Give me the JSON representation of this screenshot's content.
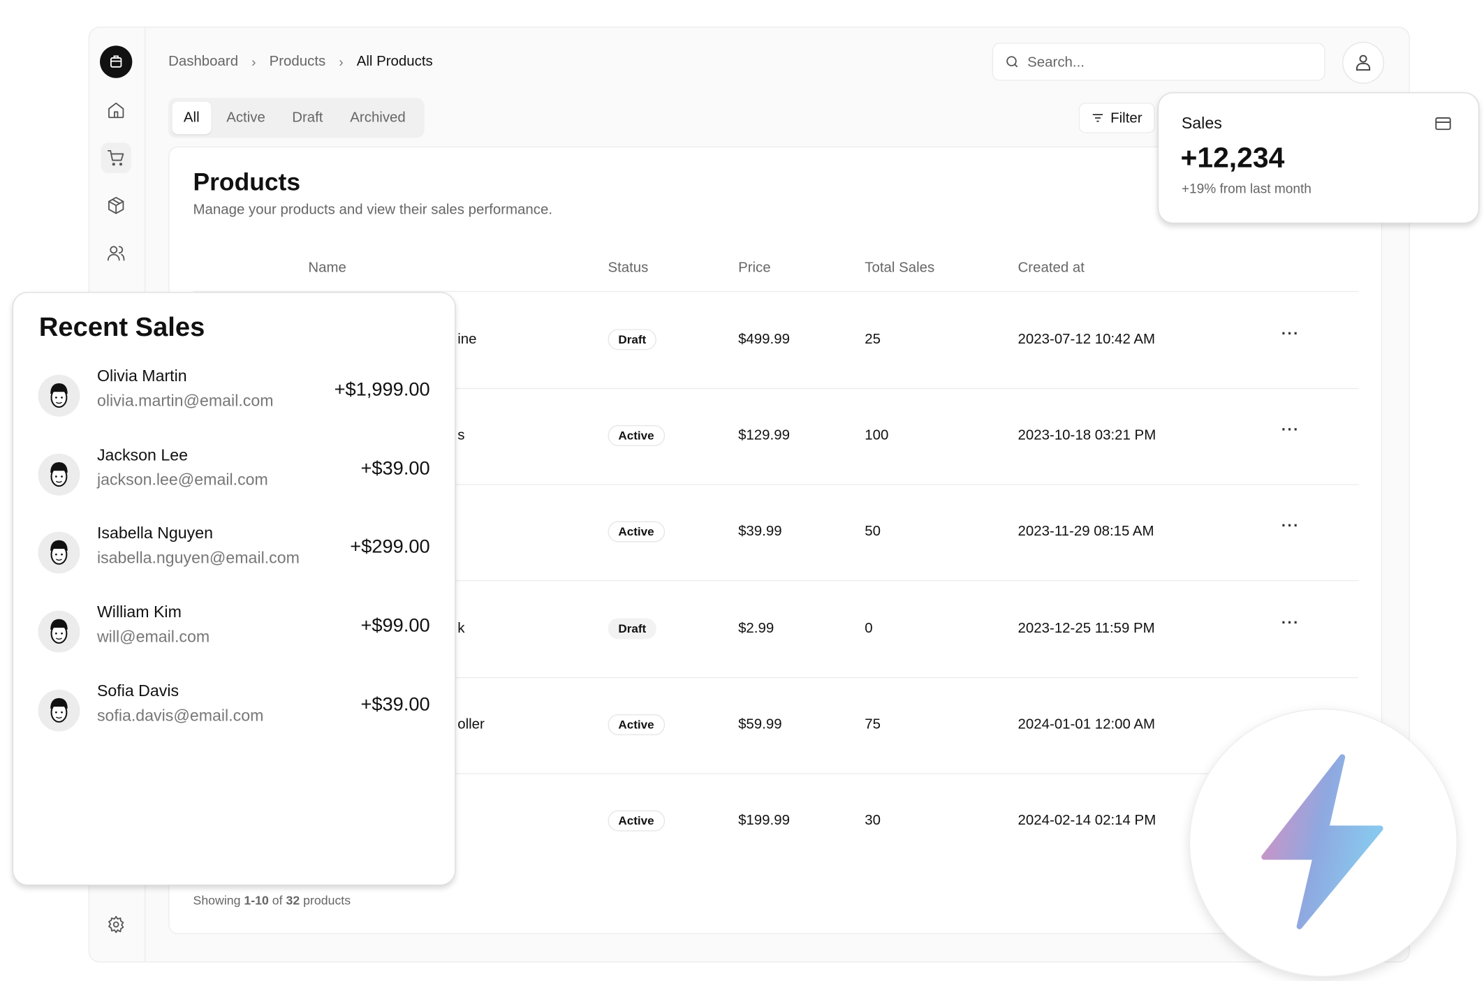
{
  "breadcrumb": [
    "Dashboard",
    "Products",
    "All Products"
  ],
  "search": {
    "placeholder": "Search..."
  },
  "tabs": [
    "All",
    "Active",
    "Draft",
    "Archived"
  ],
  "filter_label": "Filter",
  "products": {
    "title": "Products",
    "subtitle": "Manage your products and view their sales performance.",
    "columns": [
      "Name",
      "Status",
      "Price",
      "Total Sales",
      "Created at"
    ],
    "rows": [
      {
        "name": "ine",
        "status": "Draft",
        "price": "$499.99",
        "sales": "25",
        "created": "2023-07-12 10:42 AM"
      },
      {
        "name": "s",
        "status": "Active",
        "price": "$129.99",
        "sales": "100",
        "created": "2023-10-18 03:21 PM"
      },
      {
        "name": "",
        "status": "Active",
        "price": "$39.99",
        "sales": "50",
        "created": "2023-11-29 08:15 AM"
      },
      {
        "name": "k",
        "status": "Draft",
        "price": "$2.99",
        "sales": "0",
        "created": "2023-12-25 11:59 PM"
      },
      {
        "name": "oller",
        "status": "Active",
        "price": "$59.99",
        "sales": "75",
        "created": "2024-01-01 12:00 AM"
      },
      {
        "name": "",
        "status": "Active",
        "price": "$199.99",
        "sales": "30",
        "created": "2024-02-14 02:14 PM"
      }
    ],
    "footer": {
      "prefix": "Showing",
      "range": "1-10",
      "of": "of",
      "total": "32",
      "suffix": "products"
    }
  },
  "sales_card": {
    "title": "Sales",
    "value": "+12,234",
    "delta": "+19% from last month",
    "icon": "credit-card-icon"
  },
  "recent_sales": {
    "title": "Recent Sales",
    "items": [
      {
        "name": "Olivia Martin",
        "email": "olivia.martin@email.com",
        "amount": "+$1,999.00"
      },
      {
        "name": "Jackson Lee",
        "email": "jackson.lee@email.com",
        "amount": "+$39.00"
      },
      {
        "name": "Isabella Nguyen",
        "email": "isabella.nguyen@email.com",
        "amount": "+$299.00"
      },
      {
        "name": "William Kim",
        "email": "will@email.com",
        "amount": "+$99.00"
      },
      {
        "name": "Sofia Davis",
        "email": "sofia.davis@email.com",
        "amount": "+$39.00"
      }
    ]
  },
  "colors": {
    "accent": "#111111",
    "background": "#fafafa",
    "bolt_gradient": [
      "#d98fc0",
      "#8fa8e0",
      "#88c8ee"
    ]
  }
}
